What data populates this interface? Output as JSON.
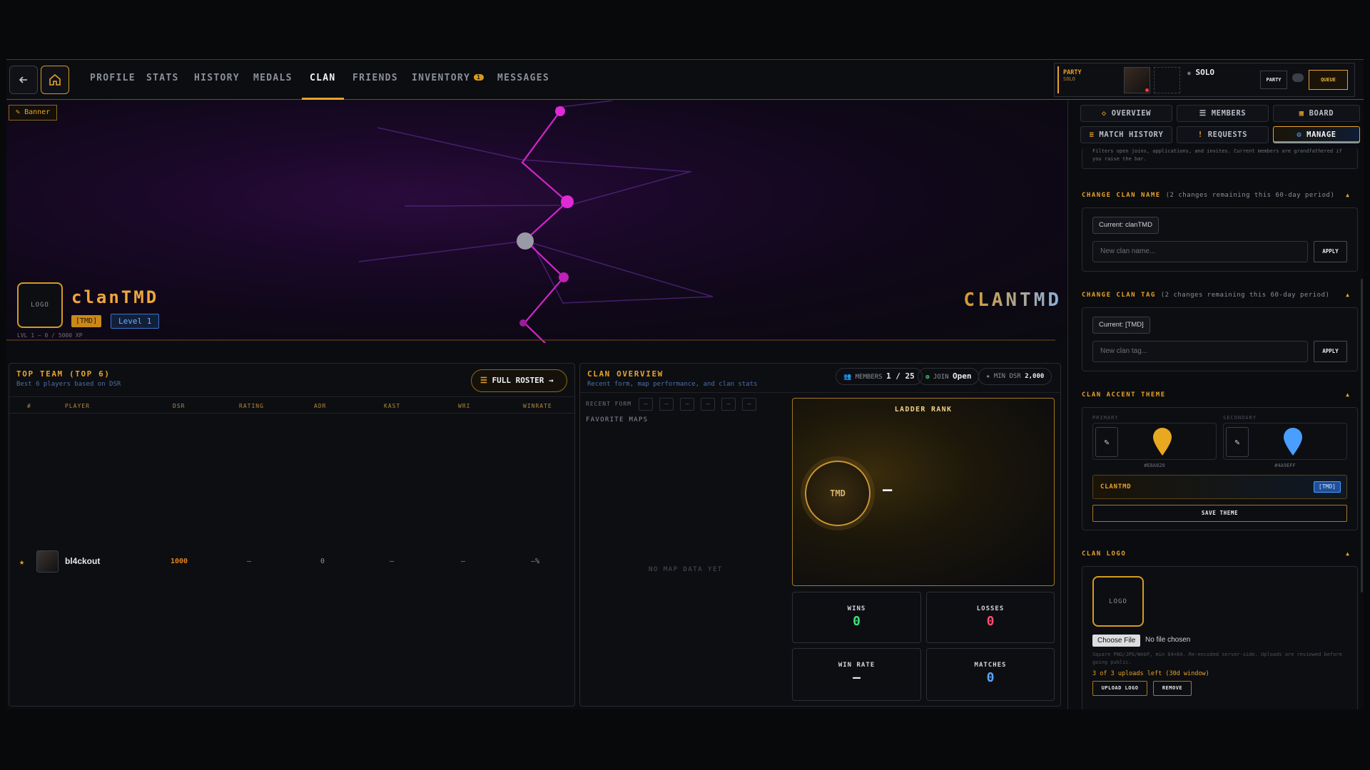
{
  "topbar": {
    "tabs": [
      {
        "label": "PROFILE"
      },
      {
        "label": "STATS"
      },
      {
        "label": "HISTORY"
      },
      {
        "label": "MEDALS"
      },
      {
        "label": "CLAN",
        "active": true
      },
      {
        "label": "FRIENDS"
      },
      {
        "label": "INVENTORY",
        "badge": "1"
      },
      {
        "label": "MESSAGES"
      }
    ],
    "party": {
      "title": "PARTY",
      "mode": "SOLO",
      "status_label": "SOLO",
      "party_button": "PARTY",
      "queue_button": "QUEUE"
    }
  },
  "banner": {
    "button_label": "Banner",
    "logo_placeholder": "LOGO",
    "clan_name": "clanTMD",
    "tag": "[TMD]",
    "level": "Level 1",
    "xp": "LVL 1 — 0 / 5000 XP",
    "big_tag": "CLANTMD"
  },
  "top_team": {
    "title": "TOP TEAM (TOP 6)",
    "subtitle": "Best 6 players based on DSR",
    "roster_button": "FULL ROSTER →",
    "columns": [
      "#",
      "PLAYER",
      "DSR",
      "RATING",
      "ADR",
      "KAST",
      "WRI",
      "WINRATE"
    ],
    "rows": [
      {
        "rank": "★",
        "player": "bl4ckout",
        "dsr": "1000",
        "rating": "—",
        "adr": "0",
        "kast": "—",
        "wri": "—",
        "winrate": "—%"
      }
    ]
  },
  "overview": {
    "title": "CLAN OVERVIEW",
    "subtitle": "Recent form, map performance, and clan stats",
    "members_label": "MEMBERS",
    "members_value": "1 / 25",
    "join_label": "JOIN",
    "join_value": "Open",
    "min_dsr_label": "MIN DSR",
    "min_dsr_value": "2,000",
    "recent_form_label": "RECENT FORM",
    "recent_form": [
      "—",
      "—",
      "—",
      "—",
      "—",
      "—"
    ],
    "favorite_maps_label": "FAVORITE MAPS",
    "no_map_data": "NO MAP DATA YET",
    "ladder_title": "LADDER RANK",
    "ladder_emblem": "TMD",
    "ladder_value": "—",
    "stats": [
      {
        "label": "WINS",
        "value": "0",
        "color": "#3fe07a"
      },
      {
        "label": "LOSSES",
        "value": "0",
        "color": "#ff4d6d"
      },
      {
        "label": "WIN RATE",
        "value": "—",
        "color": "#e8ebef"
      },
      {
        "label": "MATCHES",
        "value": "0",
        "color": "#58a6ff"
      }
    ]
  },
  "side": {
    "tabs": [
      {
        "label": "OVERVIEW",
        "icon": "diamond-icon"
      },
      {
        "label": "MEMBERS",
        "icon": "list-icon"
      },
      {
        "label": "BOARD",
        "icon": "board-icon"
      },
      {
        "label": "MATCH HISTORY",
        "icon": "history-icon"
      },
      {
        "label": "REQUESTS",
        "icon": "alert-icon"
      },
      {
        "label": "MANAGE",
        "icon": "gear-icon",
        "active": true
      }
    ],
    "note": "Filters open joins, applications, and invites. Current members are grandfathered if you raise the bar.",
    "change_name": {
      "title": "CHANGE CLAN NAME",
      "limit": "(2 changes remaining this 60-day period)",
      "current": "Current: clanTMD",
      "placeholder": "New clan name...",
      "apply": "APPLY"
    },
    "change_tag": {
      "title": "CHANGE CLAN TAG",
      "limit": "(2 changes remaining this 60-day period)",
      "current": "Current: [TMD]",
      "placeholder": "New clan tag...",
      "apply": "APPLY"
    },
    "accent": {
      "title": "CLAN ACCENT THEME",
      "primary_label": "PRIMARY",
      "secondary_label": "SECONDARY",
      "primary_hex": "#E8A820",
      "secondary_hex": "#4A9EFF",
      "preview_name": "CLANTMD",
      "preview_tag": "[TMD]",
      "save": "SAVE THEME"
    },
    "logo": {
      "title": "CLAN LOGO",
      "placeholder": "LOGO",
      "choose_file": "Choose File",
      "no_file": "No file chosen",
      "hint": "Square PNG/JPG/WebP, min 64×64. Re-encoded server-side. Uploads are reviewed before going public.",
      "uploads_left": "3 of 3 uploads left (30d window)",
      "upload": "UPLOAD LOGO",
      "remove": "REMOVE"
    }
  }
}
